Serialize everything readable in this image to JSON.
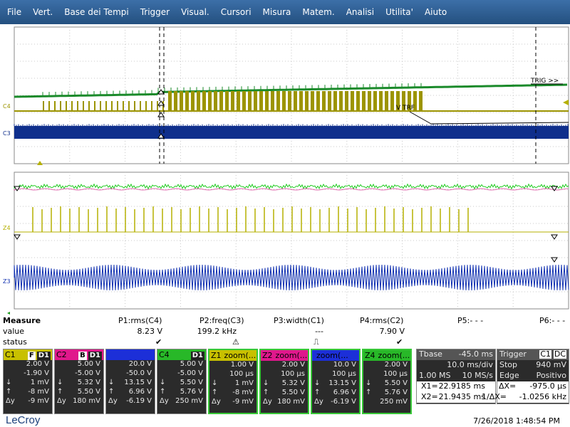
{
  "menu": [
    "File",
    "Vert.",
    "Base dei Tempi",
    "Trigger",
    "Visual.",
    "Cursori",
    "Misura",
    "Matem.",
    "Analisi",
    "Utilita'",
    "Aiuto"
  ],
  "upper_grid": {
    "labels": {
      "c4": "C4",
      "c3": "C3",
      "v_trf": "V TRF",
      "trig_marker": "TRIG >>"
    }
  },
  "lower_grid": {
    "labels": {
      "z4": "Z4",
      "z3": "Z3"
    }
  },
  "measure": {
    "header": "Measure",
    "row_value": "value",
    "row_status": "status",
    "params": [
      {
        "label": "P1:rms(C4)",
        "value": "8.23 V",
        "status": "✔"
      },
      {
        "label": "P2:freq(C3)",
        "value": "199.2 kHz",
        "status": "⚠"
      },
      {
        "label": "P3:width(C1)",
        "value": "---",
        "status": "⎍"
      },
      {
        "label": "P4:rms(C2)",
        "value": "7.90 V",
        "status": "✔"
      },
      {
        "label": "P5:- - -",
        "value": "",
        "status": ""
      },
      {
        "label": "P6:- - -",
        "value": "",
        "status": ""
      }
    ]
  },
  "channels": [
    {
      "name": "C1",
      "color": "#c8c000",
      "tags": [
        "F",
        "D1"
      ],
      "v1": "2.00 V",
      "v2": "-1.90 V",
      "rows": [
        [
          "↓",
          "1 mV"
        ],
        [
          "↑",
          "-8 mV"
        ],
        [
          "Δy",
          "-9 mV"
        ]
      ]
    },
    {
      "name": "C2",
      "color": "#e0188c",
      "tags": [
        "B",
        "D1"
      ],
      "v1": "5.00 V",
      "v2": "-5.00 V",
      "rows": [
        [
          "↓",
          "5.32 V"
        ],
        [
          "↑",
          "5.50 V"
        ],
        [
          "Δy",
          "180 mV"
        ]
      ]
    },
    {
      "name": "",
      "color": "#1c2fd8",
      "tags": [
        "",
        ""
      ],
      "v1": "20.0 V",
      "v2": "-50.0 V",
      "rows": [
        [
          "↓",
          "13.15 V"
        ],
        [
          "↑",
          "6.96 V"
        ],
        [
          "Δy",
          "-6.19 V"
        ]
      ]
    },
    {
      "name": "C4",
      "color": "#28b828",
      "tags": [
        "D1"
      ],
      "v1": "5.00 V",
      "v2": "-5.00 V",
      "rows": [
        [
          "↓",
          "5.50 V"
        ],
        [
          "↑",
          "5.76 V"
        ],
        [
          "Δy",
          "250 mV"
        ]
      ]
    },
    {
      "name": "Z1",
      "color": "#c8c000",
      "title": "zoom(...",
      "v1": "1.00 V",
      "v2": "100 µs",
      "rows": [
        [
          "↓",
          "1 mV"
        ],
        [
          "↑",
          "-8 mV"
        ],
        [
          "Δy",
          "-9 mV"
        ]
      ]
    },
    {
      "name": "Z2",
      "color": "#e0188c",
      "title": "zoom(...",
      "v1": "2.00 V",
      "v2": "100 µs",
      "rows": [
        [
          "↓",
          "5.32 V"
        ],
        [
          "↑",
          "5.50 V"
        ],
        [
          "Δy",
          "180 mV"
        ]
      ]
    },
    {
      "name": "",
      "color": "#1c2fd8",
      "title": "zoom(...",
      "v1": "10.0 V",
      "v2": "100 µs",
      "rows": [
        [
          "↓",
          "13.15 V"
        ],
        [
          "↑",
          "6.96 V"
        ],
        [
          "Δy",
          "-6.19 V"
        ]
      ]
    },
    {
      "name": "Z4",
      "color": "#28b828",
      "title": "zoom(...",
      "v1": "2.00 V",
      "v2": "100 µs",
      "rows": [
        [
          "↓",
          "5.50 V"
        ],
        [
          "↑",
          "5.76 V"
        ],
        [
          "",
          "250 mV"
        ]
      ]
    }
  ],
  "timebase": {
    "title": "Tbase",
    "value": "-45.0 ms",
    "div": "10.0 ms/div",
    "samples": "1.00 MS",
    "rate": "10 MS/s",
    "x1_label": "X1=",
    "x1_value": "22.9185 ms",
    "x2_label": "X2=",
    "x2_value": "21.9435 ms"
  },
  "trigger": {
    "title": "Trigger",
    "tag1": "C1",
    "tag2": "DC",
    "mode": "Stop",
    "level": "940 mV",
    "type": "Edge",
    "slope": "Positivo",
    "dx_label": "ΔX=",
    "dx_value": "-975.0 µs",
    "inv_label": "1/ΔX=",
    "inv_value": "-1.0256 kHz"
  },
  "footer": {
    "logo": "LeCroy",
    "timestamp": "7/26/2018 1:48:54 PM"
  }
}
